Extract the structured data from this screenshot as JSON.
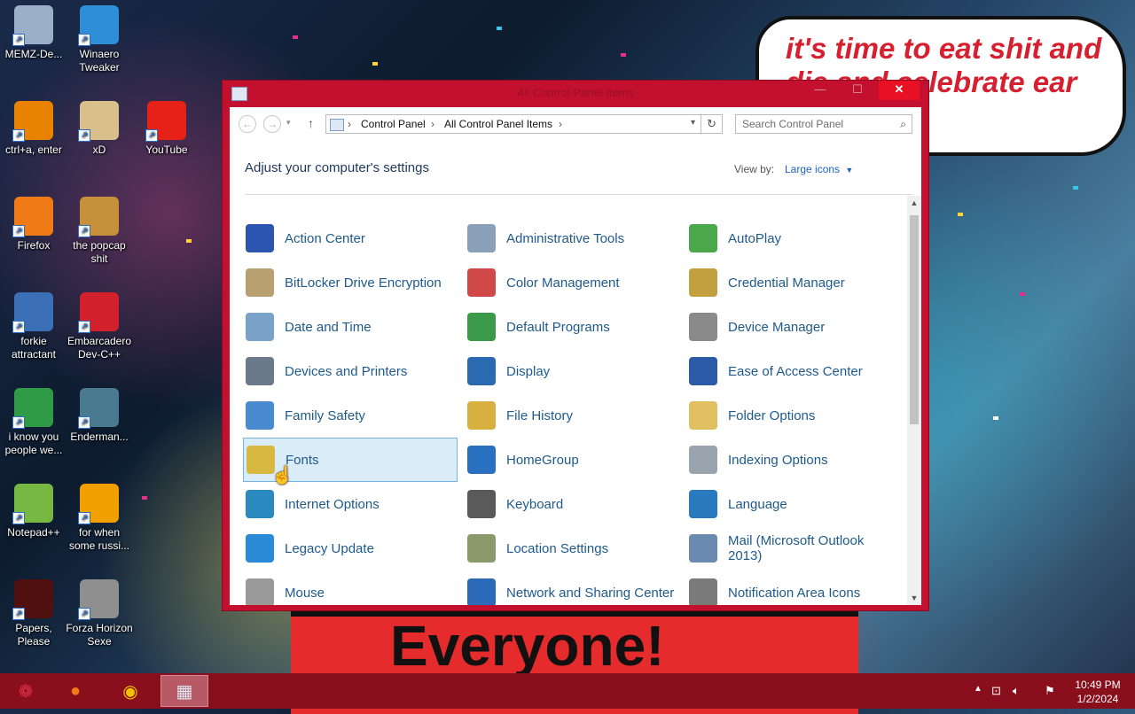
{
  "desktop": {
    "icons": [
      {
        "label": "MEMZ-De...",
        "icon": "recycle-bin-icon",
        "color": "#9ab0c8"
      },
      {
        "label": "Winaero Tweaker",
        "icon": "winaero-icon",
        "color": "#2e8fd8"
      },
      {
        "label": "ctrl+a, enter",
        "icon": "ring-icon",
        "color": "#e98200"
      },
      {
        "label": "xD",
        "icon": "xd-icon",
        "color": "#d9c08a"
      },
      {
        "label": "YouTube",
        "icon": "youtube-icon",
        "color": "#e62117"
      },
      {
        "label": "Firefox",
        "icon": "firefox-icon",
        "color": "#f07a16"
      },
      {
        "label": "the popcap shit",
        "icon": "music-file-icon",
        "color": "#c7913c"
      },
      {
        "label": "forkie attractant",
        "icon": "settings-monitor-icon",
        "color": "#3b6fb6"
      },
      {
        "label": "Embarcadero Dev-C++",
        "icon": "devcpp-icon",
        "color": "#d2212c"
      },
      {
        "label": "i know you people we...",
        "icon": "chrome-icon",
        "color": "#2f9b47"
      },
      {
        "label": "Enderman...",
        "icon": "image-file-icon",
        "color": "#4a7a90"
      },
      {
        "label": "Notepad++",
        "icon": "notepad-plus-icon",
        "color": "#77b843"
      },
      {
        "label": "for when some russi...",
        "icon": "de-icon",
        "color": "#f2a000"
      },
      {
        "label": "Papers, Please",
        "icon": "papers-please-icon",
        "color": "#501010"
      },
      {
        "label": "Forza Horizon Sexe",
        "icon": "flash-icon",
        "color": "#8f8f8f"
      }
    ],
    "speech_bubble_text": "it's time to eat shit and die and celebrate ear",
    "poster_text": "Everyone!"
  },
  "window": {
    "title": "All Control Panel Items",
    "breadcrumb": [
      "Control Panel",
      "All Control Panel Items"
    ],
    "search_placeholder": "Search Control Panel",
    "heading": "Adjust your computer's settings",
    "view_by_label": "View by:",
    "view_by_value": "Large icons",
    "items": [
      {
        "label": "Action Center",
        "icon": "flag-icon",
        "color": "#2c55b0"
      },
      {
        "label": "Administrative Tools",
        "icon": "admin-tools-icon",
        "color": "#8aa0b8"
      },
      {
        "label": "AutoPlay",
        "icon": "autoplay-icon",
        "color": "#4aa84a"
      },
      {
        "label": "BitLocker Drive Encryption",
        "icon": "bitlocker-icon",
        "color": "#b8a070"
      },
      {
        "label": "Color Management",
        "icon": "color-management-icon",
        "color": "#d04848"
      },
      {
        "label": "Credential Manager",
        "icon": "credential-icon",
        "color": "#c2a040"
      },
      {
        "label": "Date and Time",
        "icon": "clock-icon",
        "color": "#7aa2c8"
      },
      {
        "label": "Default Programs",
        "icon": "default-programs-icon",
        "color": "#3a9a4a"
      },
      {
        "label": "Device Manager",
        "icon": "device-manager-icon",
        "color": "#8a8a8a"
      },
      {
        "label": "Devices and Printers",
        "icon": "printer-icon",
        "color": "#6a7a8a"
      },
      {
        "label": "Display",
        "icon": "display-icon",
        "color": "#2a6ab0"
      },
      {
        "label": "Ease of Access Center",
        "icon": "ease-of-access-icon",
        "color": "#2a5aa8"
      },
      {
        "label": "Family Safety",
        "icon": "family-icon",
        "color": "#4a8ad0"
      },
      {
        "label": "File History",
        "icon": "file-history-icon",
        "color": "#d8b040"
      },
      {
        "label": "Folder Options",
        "icon": "folder-options-icon",
        "color": "#e0c060"
      },
      {
        "label": "Fonts",
        "icon": "fonts-icon",
        "color": "#d8b840"
      },
      {
        "label": "HomeGroup",
        "icon": "homegroup-icon",
        "color": "#2a70c0"
      },
      {
        "label": "Indexing Options",
        "icon": "indexing-icon",
        "color": "#9aa4ae"
      },
      {
        "label": "Internet Options",
        "icon": "internet-options-icon",
        "color": "#2a8ac0"
      },
      {
        "label": "Keyboard",
        "icon": "keyboard-icon",
        "color": "#5a5a5a"
      },
      {
        "label": "Language",
        "icon": "language-icon",
        "color": "#2a7ac0"
      },
      {
        "label": "Legacy Update",
        "icon": "update-icon",
        "color": "#2a8ad8"
      },
      {
        "label": "Location Settings",
        "icon": "location-icon",
        "color": "#8a9a6a"
      },
      {
        "label": "Mail (Microsoft Outlook 2013)",
        "icon": "mail-icon",
        "color": "#6a8ab0"
      },
      {
        "label": "Mouse",
        "icon": "mouse-icon",
        "color": "#9a9a9a"
      },
      {
        "label": "Network and Sharing Center",
        "icon": "network-icon",
        "color": "#2a6ab8"
      },
      {
        "label": "Notification Area Icons",
        "icon": "notification-icon",
        "color": "#7a7a7a"
      }
    ],
    "selected_item": "Fonts"
  },
  "taskbar": {
    "clock_time": "10:49 PM",
    "clock_date": "1/2/2024",
    "buttons": [
      "start-button",
      "firefox-taskbar",
      "chrome-taskbar",
      "control-panel-taskbar"
    ]
  }
}
